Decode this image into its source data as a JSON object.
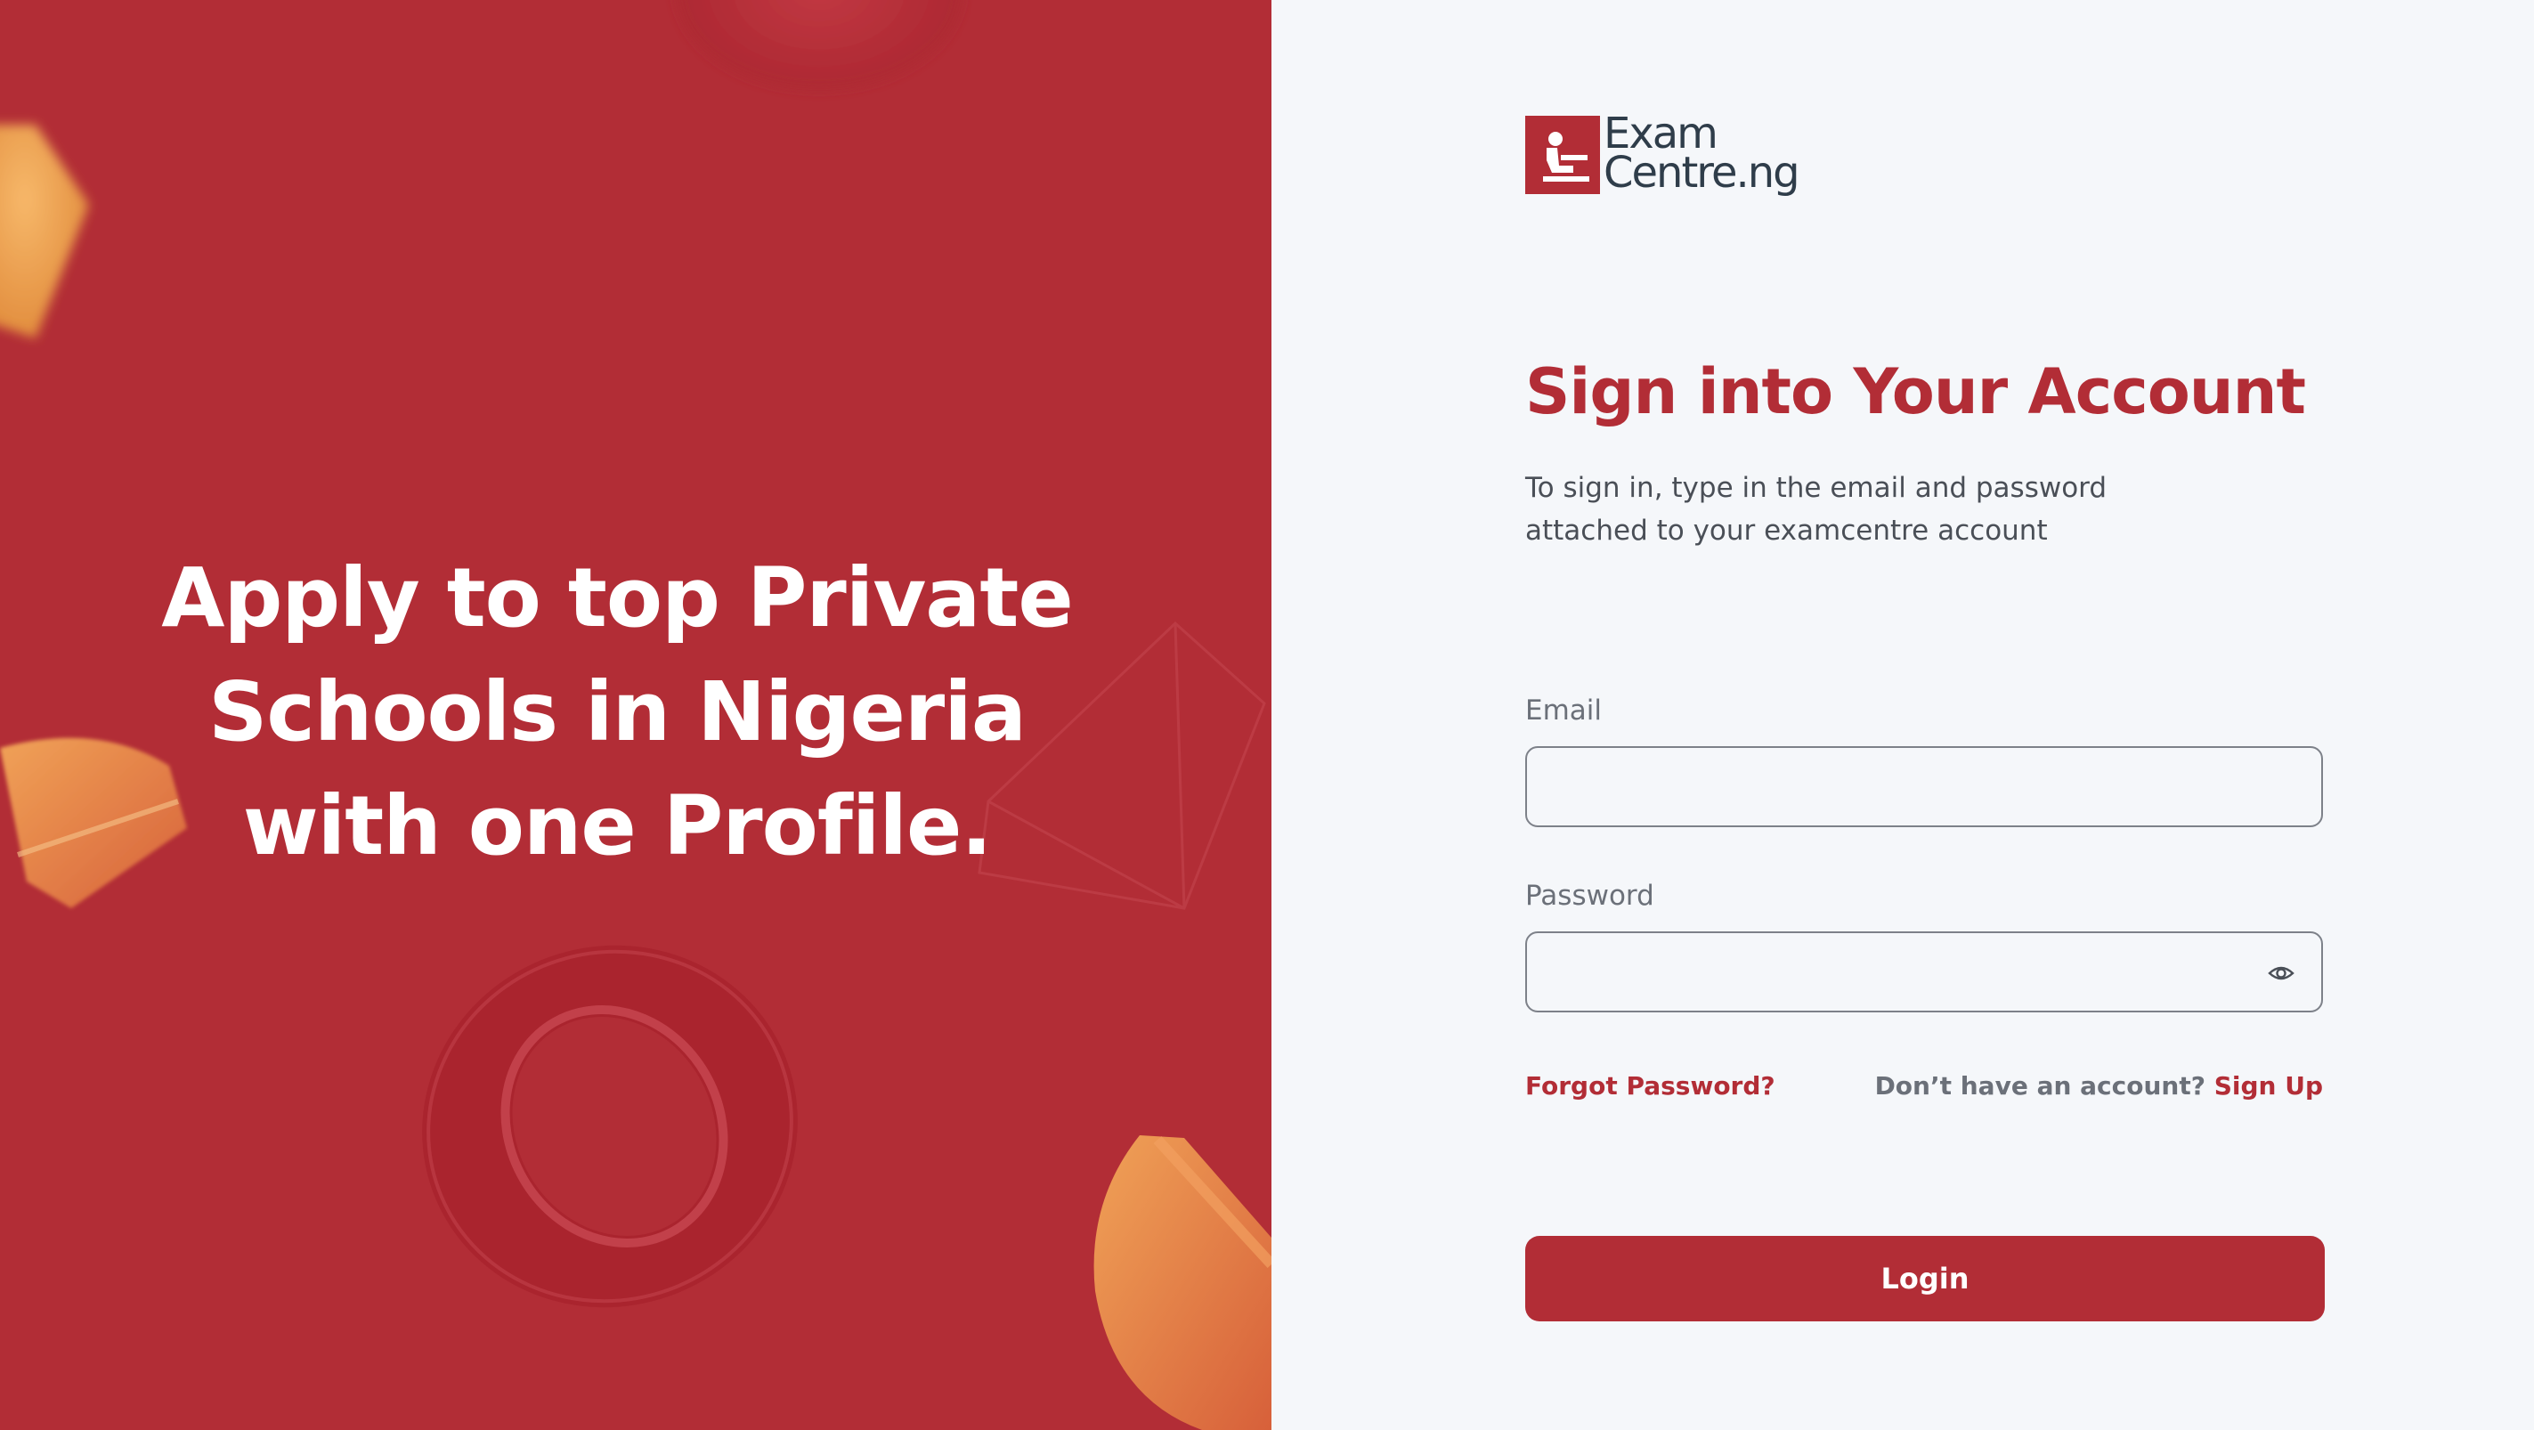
{
  "colors": {
    "brand_red": "#b22d36",
    "panel_background": "#f5f7fa",
    "text_dark": "#2f3d4a",
    "text_muted": "#6b7079"
  },
  "hero": {
    "headline_lines": [
      "Apply to top Private",
      "Schools in Nigeria",
      "with one Profile."
    ]
  },
  "logo": {
    "icon": "student-at-desk-icon",
    "line1": "Exam",
    "line2": "Centre.ng"
  },
  "form": {
    "title": "Sign into Your Account",
    "subtitle": "To sign in, type in the email and password attached to your examcentre account",
    "email_label": "Email",
    "email_value": "",
    "password_label": "Password",
    "password_value": "",
    "password_toggle_icon": "eye-icon",
    "forgot_password": "Forgot Password?",
    "signup_prompt": "Don’t have an account?",
    "signup_link": "Sign Up",
    "login_button": "Login"
  }
}
